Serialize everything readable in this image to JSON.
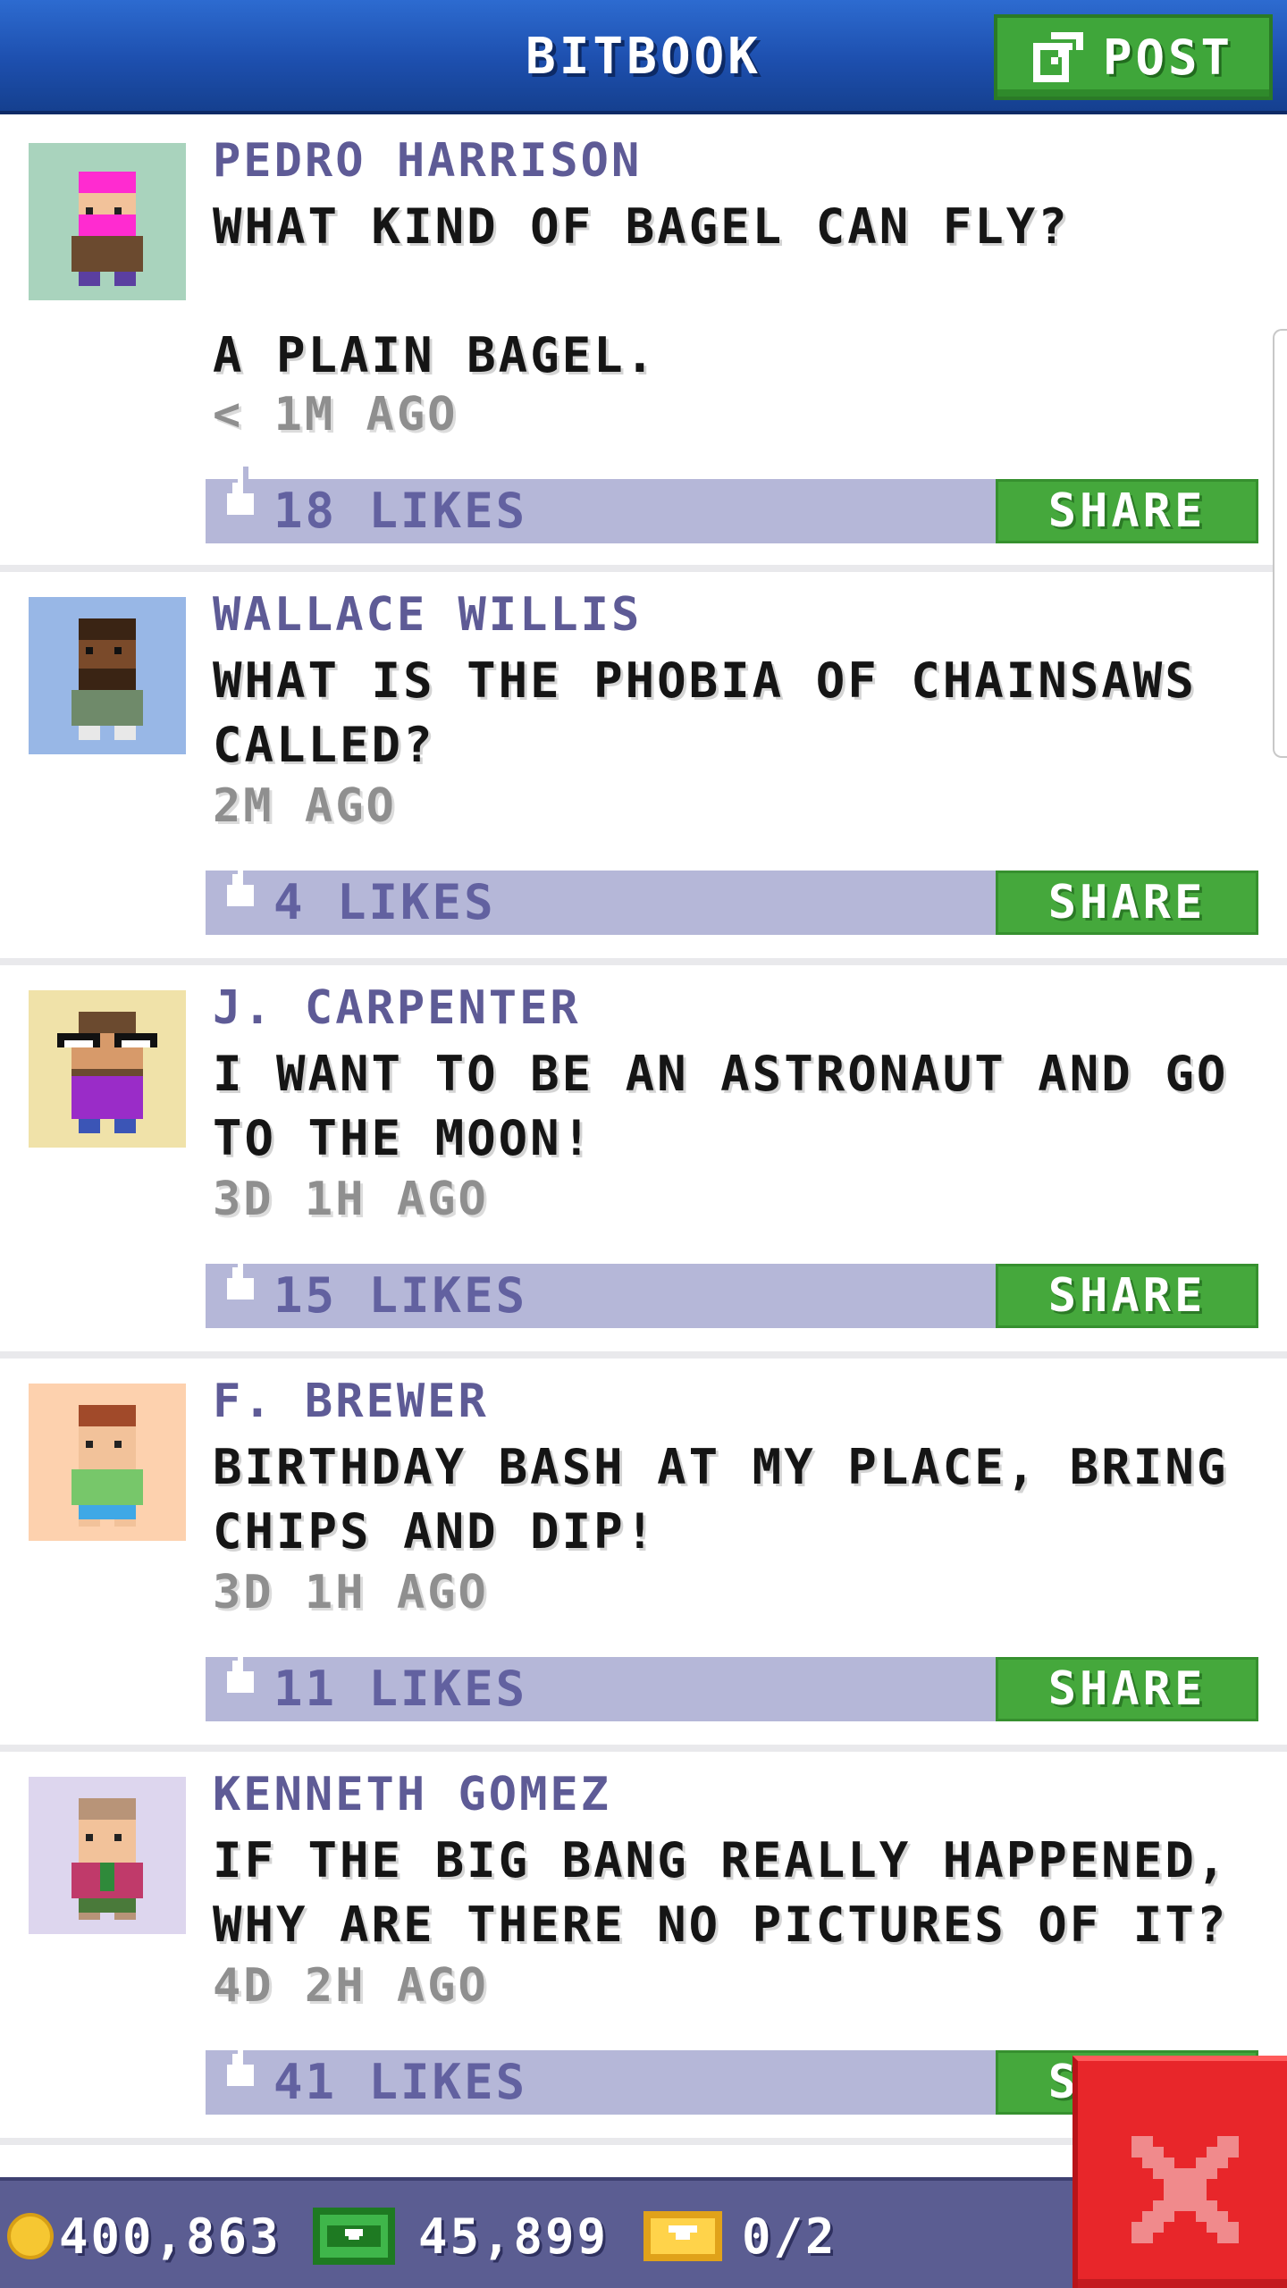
{
  "header": {
    "title": "BITBOOK",
    "post_label": "POST"
  },
  "colors": {
    "header_blue": "#1d4fae",
    "accent_green": "#45a83c",
    "like_bar": "#b5b7d8",
    "author_purple": "#5e5b96",
    "status_bar": "#5b5d92",
    "close_red": "#e8262a"
  },
  "posts": [
    {
      "author": "PEDRO HARRISON",
      "text": "WHAT KIND OF BAGEL CAN FLY?\n\nA PLAIN BAGEL.",
      "time": "< 1M AGO",
      "likes": "18 LIKES",
      "share": "SHARE",
      "avatar_bg": "#a9d3bd",
      "avatar_icon": "pink-hair-person-icon"
    },
    {
      "author": "WALLACE WILLIS",
      "text": "WHAT IS THE PHOBIA OF CHAINSAWS CALLED?",
      "time": "2M AGO",
      "likes": "4 LIKES",
      "share": "SHARE",
      "avatar_bg": "#98b7e6",
      "avatar_icon": "bearded-person-icon"
    },
    {
      "author": "J. CARPENTER",
      "text": "I WANT TO BE AN ASTRONAUT AND GO TO THE MOON!",
      "time": "3D 1H AGO",
      "likes": "15 LIKES",
      "share": "SHARE",
      "avatar_bg": "#f0e2a9",
      "avatar_icon": "glasses-person-icon"
    },
    {
      "author": "F. BREWER",
      "text": "BIRTHDAY BASH AT MY PLACE, BRING CHIPS AND DIP!",
      "time": "3D 1H AGO",
      "likes": "11 LIKES",
      "share": "SHARE",
      "avatar_bg": "#fdd1ae",
      "avatar_icon": "green-shirt-person-icon"
    },
    {
      "author": "KENNETH GOMEZ",
      "text": "IF THE BIG BANG REALLY HAPPENED, WHY ARE THERE NO PICTURES OF IT?",
      "time": "4D 2H AGO",
      "likes": "41 LIKES",
      "share": "SHARE",
      "avatar_bg": "#ddd6ee",
      "avatar_icon": "tie-person-icon"
    }
  ],
  "status": {
    "coins": "400,863",
    "bux": "45,899",
    "tickets": "0/2"
  }
}
